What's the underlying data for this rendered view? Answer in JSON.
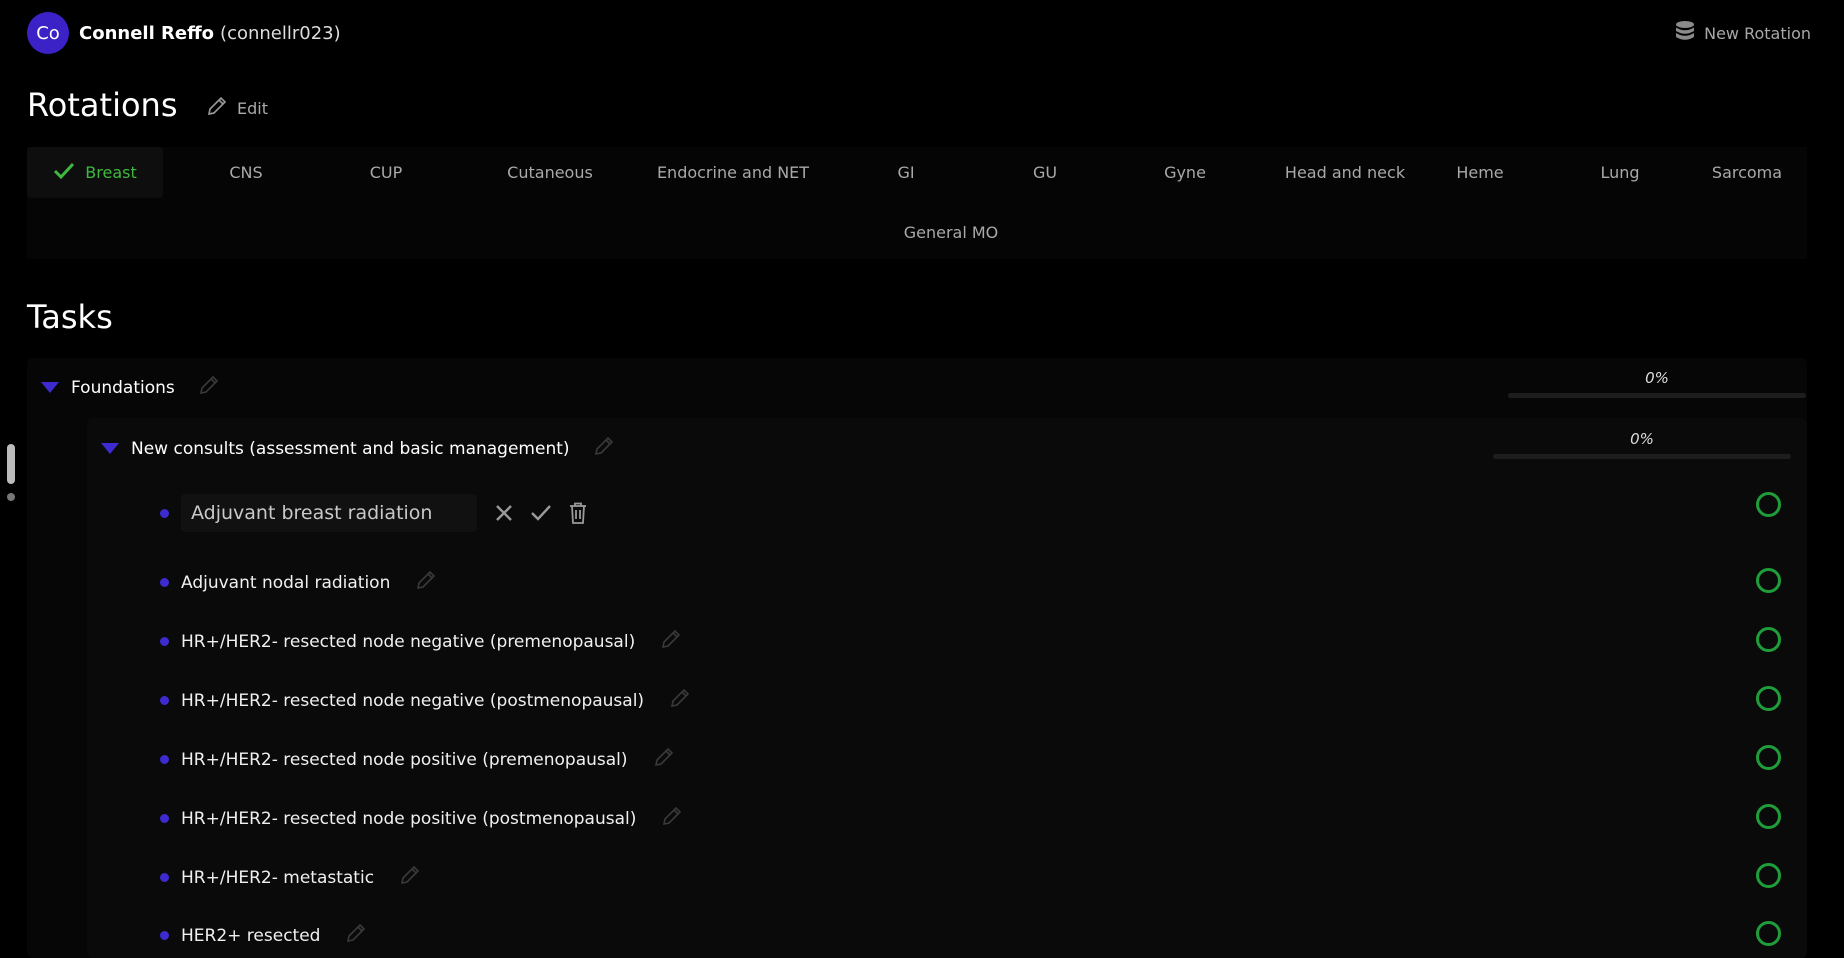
{
  "user": {
    "initials": "Co",
    "name": "Connell Reffo",
    "handle": "(connellr023)"
  },
  "header": {
    "new_rotation_label": "New Rotation"
  },
  "rotations": {
    "title": "Rotations",
    "edit_label": "Edit",
    "tabs": [
      "Breast",
      "CNS",
      "CUP",
      "Cutaneous",
      "Endocrine and NET",
      "GI",
      "GU",
      "Gyne",
      "Head and neck",
      "Heme",
      "Lung",
      "Sarcoma",
      "General MO"
    ],
    "active_tab": "Breast"
  },
  "tasks": {
    "title": "Tasks",
    "group": {
      "label": "Foundations",
      "progress": "0%",
      "progress_value": 0
    },
    "subgroup": {
      "label": "New consults (assessment and basic management)",
      "progress": "0%",
      "progress_value": 0
    },
    "editing": {
      "value": "Adjuvant breast radiation"
    },
    "items": [
      "Adjuvant nodal radiation",
      "HR+/HER2- resected node negative (premenopausal)",
      "HR+/HER2- resected node negative (postmenopausal)",
      "HR+/HER2- resected node positive (premenopausal)",
      "HR+/HER2- resected node positive (postmenopausal)",
      "HR+/HER2- metastatic",
      "HER2+ resected"
    ]
  },
  "colors": {
    "accent": "#3d2bd0",
    "success": "#1f9d3a",
    "active_tab_text": "#3fb83f"
  }
}
